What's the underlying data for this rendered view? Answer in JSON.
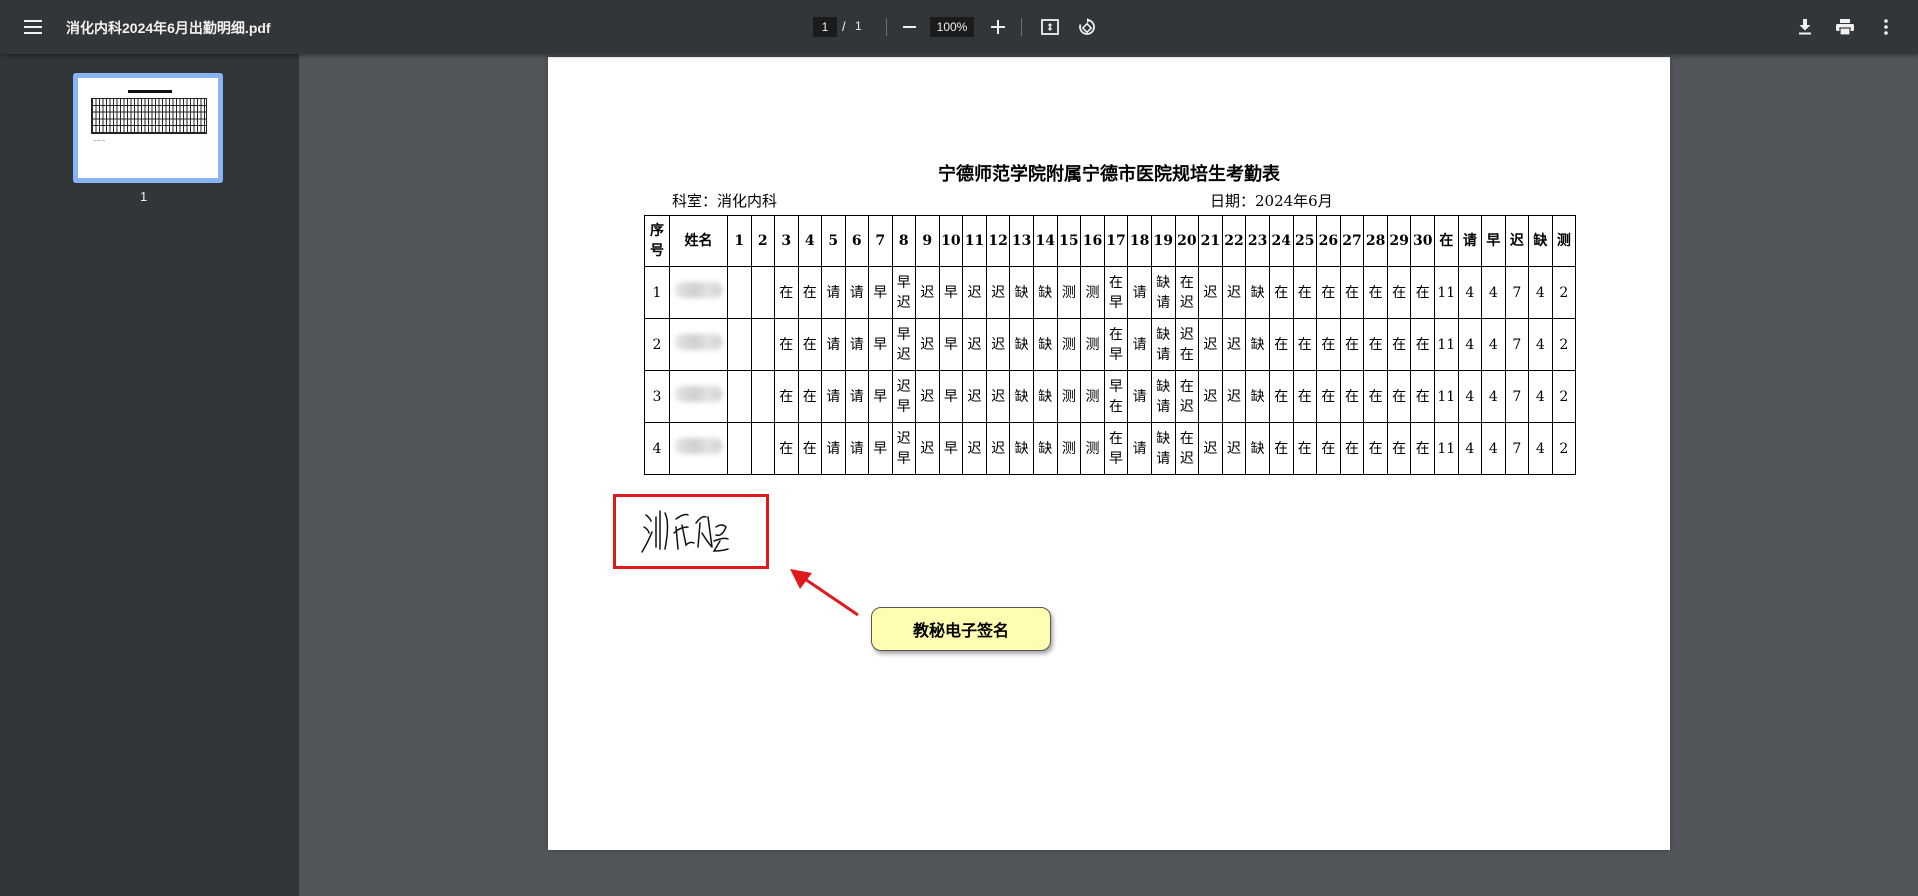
{
  "toolbar": {
    "file_title": "消化内科2024年6月出勤明细.pdf",
    "current_page": "1",
    "page_separator": "/",
    "total_pages": "1",
    "zoom": "100%"
  },
  "sidebar": {
    "thumbnail_label": "1"
  },
  "document": {
    "title": "宁德师范学院附属宁德市医院规培生考勤表",
    "department": "科室：消化内科",
    "date": "日期：2024年6月",
    "headers": [
      "序号",
      "姓名",
      "1",
      "2",
      "3",
      "4",
      "5",
      "6",
      "7",
      "8",
      "9",
      "10",
      "11",
      "12",
      "13",
      "14",
      "15",
      "16",
      "17",
      "18",
      "19",
      "20",
      "21",
      "22",
      "23",
      "24",
      "25",
      "26",
      "27",
      "28",
      "29",
      "30",
      "在",
      "请",
      "早",
      "迟",
      "缺",
      "测"
    ],
    "rows": [
      {
        "no": "1",
        "cells": [
          "",
          "",
          "在",
          "在",
          "请",
          "请",
          "早",
          "早迟",
          "迟",
          "早",
          "迟",
          "迟",
          "缺",
          "缺",
          "测",
          "测",
          "在早",
          "请",
          "缺请",
          "在迟",
          "迟",
          "迟",
          "缺",
          "在",
          "在",
          "在",
          "在",
          "在",
          "在",
          "在",
          "11",
          "4",
          "4",
          "7",
          "4",
          "2"
        ]
      },
      {
        "no": "2",
        "cells": [
          "",
          "",
          "在",
          "在",
          "请",
          "请",
          "早",
          "早迟",
          "迟",
          "早",
          "迟",
          "迟",
          "缺",
          "缺",
          "测",
          "测",
          "在早",
          "请",
          "缺请",
          "迟在",
          "迟",
          "迟",
          "缺",
          "在",
          "在",
          "在",
          "在",
          "在",
          "在",
          "在",
          "11",
          "4",
          "4",
          "7",
          "4",
          "2"
        ]
      },
      {
        "no": "3",
        "cells": [
          "",
          "",
          "在",
          "在",
          "请",
          "请",
          "早",
          "迟早",
          "迟",
          "早",
          "迟",
          "迟",
          "缺",
          "缺",
          "测",
          "测",
          "早在",
          "请",
          "缺请",
          "在迟",
          "迟",
          "迟",
          "缺",
          "在",
          "在",
          "在",
          "在",
          "在",
          "在",
          "在",
          "11",
          "4",
          "4",
          "7",
          "4",
          "2"
        ]
      },
      {
        "no": "4",
        "cells": [
          "",
          "",
          "在",
          "在",
          "请",
          "请",
          "早",
          "迟早",
          "迟",
          "早",
          "迟",
          "迟",
          "缺",
          "缺",
          "测",
          "测",
          "在早",
          "请",
          "缺请",
          "在迟",
          "迟",
          "迟",
          "缺",
          "在",
          "在",
          "在",
          "在",
          "在",
          "在",
          "在",
          "11",
          "4",
          "4",
          "7",
          "4",
          "2"
        ]
      }
    ],
    "signature_text": "测试人员",
    "callout": "教秘电子签名"
  },
  "colors": {
    "toolbar": "#323639",
    "background": "#525659",
    "highlight": "#e0191c",
    "callout": "#fffdb0",
    "thumb_border": "#8ab4f8"
  }
}
